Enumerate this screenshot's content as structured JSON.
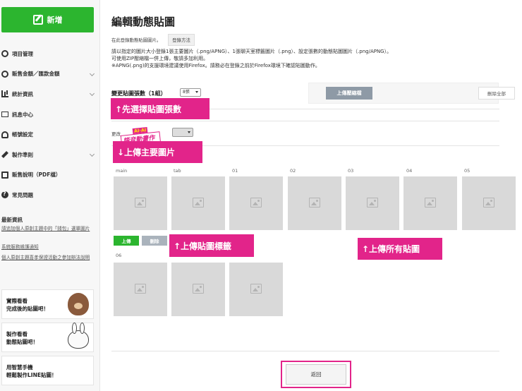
{
  "sidebar": {
    "new_label": "新增",
    "items": [
      {
        "label": "項目管理",
        "icon": "gear-icon",
        "chevron": false
      },
      {
        "label": "販售金額／匯款金額",
        "icon": "coin-icon",
        "chevron": true
      },
      {
        "label": "統計資訊",
        "icon": "chart-icon",
        "chevron": true
      },
      {
        "label": "訊息中心",
        "icon": "mail-icon",
        "chevron": false
      },
      {
        "label": "帳號設定",
        "icon": "user-icon",
        "chevron": false
      },
      {
        "label": "製作準則",
        "icon": "wrench-icon",
        "chevron": true
      },
      {
        "label": "販售說明（PDF檔）",
        "icon": "book-icon",
        "chevron": false
      },
      {
        "label": "常見問題",
        "icon": "question-icon",
        "chevron": false
      }
    ],
    "news_title": "最新資訊",
    "news": [
      "請追加個人原創主題中的「錢包」選單圖片",
      "系統服務維護通知",
      "個人原創主題喜孝保證活動之參加辦法說明"
    ],
    "promos": [
      {
        "line1": "實際看看",
        "line2": "完成後的貼圖吧！",
        "mascot": "brown-bear"
      },
      {
        "line1": "製作看看",
        "line2": "動態貼圖吧！",
        "mascot": "cony-rabbit"
      },
      {
        "line1": "用智慧手機",
        "line2": "輕鬆製作LINE貼圖！",
        "mascot": ""
      }
    ]
  },
  "main": {
    "title": "編輯動態貼圖",
    "login_hint": "在此登錄動態貼圖圖片。",
    "login_button": "登錄方法",
    "desc_line1": "請以指定的圖片大小登錄1張主要圖片（.png/APNG）、1張聊天室標籤圖片（.png）、設定張數的動態貼圖圖片（.png/APNG）。",
    "desc_line2": "可使用ZIP壓縮檔一併上傳，敬請多加利用。",
    "desc_line3": "※APNG(.png)的支援環境建議使用Firefox。請務必在登錄之前於Firefox環境下確認貼圖動作。",
    "count_label": "變更貼圖張數（1組）",
    "count_value": "8張",
    "zip_button": "上傳壓縮檔",
    "delete_all": "刪除全部",
    "type_label": "更改",
    "badge_top": "AI·AI",
    "badge_main": "語音動畫作法",
    "slots_row1": [
      "main",
      "tab",
      "01",
      "02",
      "03",
      "04",
      "05"
    ],
    "slots_row2": [
      "06"
    ],
    "upload_button": "上傳",
    "delete_button": "刪除",
    "back_button": "返回"
  },
  "callouts": {
    "select_count": "↑先選擇貼圖張數",
    "upload_main": "↓上傳主要圖片",
    "upload_tab": "↑上傳貼圖標籤",
    "upload_all": "↑上傳所有貼圖"
  },
  "colors": {
    "accent_green": "#2cb52f",
    "callout_pink": "#e2248a",
    "slot_gray": "#d9d9d9"
  }
}
